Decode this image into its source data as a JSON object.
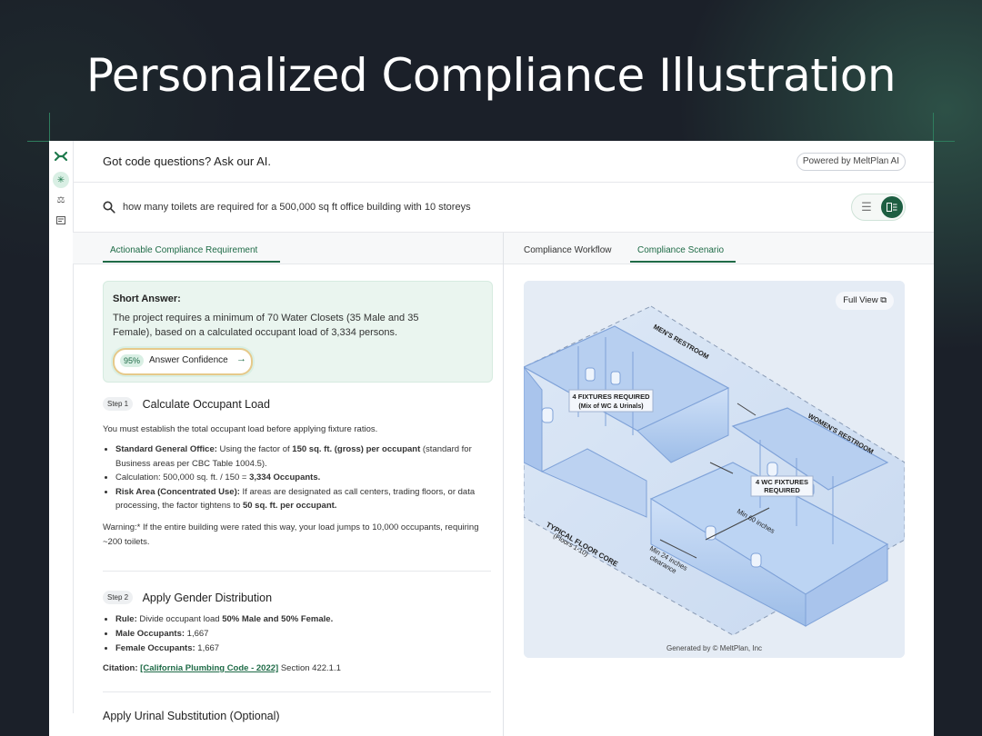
{
  "hero": {
    "title": "Personalized Compliance Illustration"
  },
  "header": {
    "title": "Got code questions? Ask our AI.",
    "powered_by": "Powered by MeltPlan AI"
  },
  "search": {
    "query": "how many toilets are required for a 500,000 sq ft office building with 10 storeys"
  },
  "rail": {
    "icons": [
      "logo-icon",
      "sparkle-icon",
      "gavel-icon",
      "document-icon"
    ]
  },
  "tabs": {
    "left": "Actionable Compliance Requirement",
    "right": [
      "Compliance Workflow",
      "Compliance Scenario"
    ],
    "active_right": "Compliance Scenario"
  },
  "short_answer": {
    "title": "Short Answer:",
    "body": "The project requires a minimum of 70 Water Closets (35 Male and 35 Female), based on a calculated occupant load of 3,334 persons.",
    "confidence_value": "95%",
    "confidence_label": "Answer Confidence"
  },
  "step1": {
    "badge": "Step 1",
    "title": "Calculate Occupant Load",
    "intro": "You must establish the total occupant load before applying fixture ratios.",
    "b1_label": "Standard General Office:",
    "b1_pre": " Using the factor of ",
    "b1_bold": "150 sq. ft. (gross) per occupant",
    "b1_post": " (standard for Business areas per CBC Table 1004.5).",
    "b2_pre": "Calculation: 500,000 sq. ft. / 150 = ",
    "b2_bold": "3,334 Occupants.",
    "b3_label": "Risk Area (Concentrated Use):",
    "b3_pre": " If areas are designated as call centers, trading floors, or data processing, the factor tightens to ",
    "b3_bold": "50 sq. ft. per occupant.",
    "warning": "Warning:* If the entire building were rated this way, your load jumps to 10,000 occupants, requiring ~200 toilets."
  },
  "step2": {
    "badge": "Step 2",
    "title": "Apply Gender Distribution",
    "rule_label": "Rule:",
    "rule_pre": " Divide occupant load ",
    "rule_bold": "50% Male and 50% Female.",
    "male_label": "Male Occupants:",
    "male_value": " 1,667",
    "female_label": "Female Occupants:",
    "female_value": " 1,667",
    "citation_label": "Citation:",
    "citation_link": "[California Plumbing Code - 2022]",
    "citation_section": " Section 422.1.1"
  },
  "step3": {
    "title": "Apply Urinal Substitution (Optional)"
  },
  "illustration": {
    "full_view": "Full View",
    "mens_label": "MEN'S RESTROOM",
    "womens_label": "WOMEN'S RESTROOM",
    "mens_fixtures_1": "4 FIXTURES REQUIRED",
    "mens_fixtures_2": "(Mix of WC & Urinals)",
    "womens_fixtures_1": "4 WC FIXTURES",
    "womens_fixtures_2": "REQUIRED",
    "floor_core_1": "TYPICAL FLOOR CORE",
    "floor_core_2": "(Floors 1-10)",
    "min60": "Min 60 inches",
    "min24_1": "Min 24 inches",
    "min24_2": "clearance",
    "generated_by": "Generated by © MeltPlan, Inc"
  },
  "colors": {
    "accent": "#1f6b47",
    "background": "#1b2029",
    "answer_bg": "#eaf5ef"
  }
}
